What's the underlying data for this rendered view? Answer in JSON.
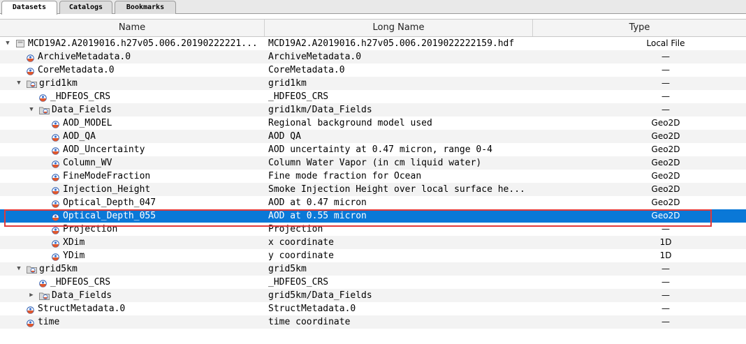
{
  "tabs": [
    "Datasets",
    "Catalogs",
    "Bookmarks"
  ],
  "columns": {
    "name": "Name",
    "long_name": "Long Name",
    "type": "Type"
  },
  "rows": [
    {
      "name": "MCD19A2.A2019016.h27v05.006.20190222221...",
      "long": "MCD19A2.A2019016.h27v05.006.2019022222159.hdf",
      "type": "Local File",
      "kind": "file",
      "level": 0,
      "arrow": "down"
    },
    {
      "name": "ArchiveMetadata.0",
      "long": "ArchiveMetadata.0",
      "type": "—",
      "kind": "ds",
      "level": 1
    },
    {
      "name": "CoreMetadata.0",
      "long": "CoreMetadata.0",
      "type": "—",
      "kind": "ds",
      "level": 1
    },
    {
      "name": "grid1km",
      "long": "grid1km",
      "type": "—",
      "kind": "folder",
      "level": 1,
      "arrow": "down"
    },
    {
      "name": "_HDFEOS_CRS",
      "long": "_HDFEOS_CRS",
      "type": "—",
      "kind": "ds",
      "level": 2
    },
    {
      "name": "Data_Fields",
      "long": "grid1km/Data_Fields",
      "type": "—",
      "kind": "folder",
      "level": 2,
      "arrow": "down"
    },
    {
      "name": "AOD_MODEL",
      "long": "Regional background model used",
      "type": "Geo2D",
      "kind": "ds",
      "level": 3
    },
    {
      "name": "AOD_QA",
      "long": "AOD QA",
      "type": "Geo2D",
      "kind": "ds",
      "level": 3
    },
    {
      "name": "AOD_Uncertainty",
      "long": "AOD uncertainty at 0.47 micron, range 0-4",
      "type": "Geo2D",
      "kind": "ds",
      "level": 3
    },
    {
      "name": "Column_WV",
      "long": "Column Water Vapor (in cm liquid water)",
      "type": "Geo2D",
      "kind": "ds",
      "level": 3
    },
    {
      "name": "FineModeFraction",
      "long": "Fine mode fraction for Ocean",
      "type": "Geo2D",
      "kind": "ds",
      "level": 3
    },
    {
      "name": "Injection_Height",
      "long": "Smoke Injection Height over local surface he...",
      "type": "Geo2D",
      "kind": "ds",
      "level": 3
    },
    {
      "name": "Optical_Depth_047",
      "long": "AOD at 0.47 micron",
      "type": "Geo2D",
      "kind": "ds",
      "level": 3
    },
    {
      "name": "Optical_Depth_055",
      "long": "AOD at 0.55 micron",
      "type": "Geo2D",
      "kind": "ds",
      "level": 3,
      "selected": true
    },
    {
      "name": "Projection",
      "long": "Projection",
      "type": "—",
      "kind": "ds",
      "level": 3
    },
    {
      "name": "XDim",
      "long": "x coordinate",
      "type": "1D",
      "kind": "ds",
      "level": 3
    },
    {
      "name": "YDim",
      "long": "y coordinate",
      "type": "1D",
      "kind": "ds",
      "level": 3
    },
    {
      "name": "grid5km",
      "long": "grid5km",
      "type": "—",
      "kind": "folder",
      "level": 1,
      "arrow": "down"
    },
    {
      "name": "_HDFEOS_CRS",
      "long": "_HDFEOS_CRS",
      "type": "—",
      "kind": "ds",
      "level": 2
    },
    {
      "name": "Data_Fields",
      "long": "grid5km/Data_Fields",
      "type": "—",
      "kind": "folder",
      "level": 2,
      "arrow": "right"
    },
    {
      "name": "StructMetadata.0",
      "long": "StructMetadata.0",
      "type": "—",
      "kind": "ds",
      "level": 1
    },
    {
      "name": "time",
      "long": "time coordinate",
      "type": "—",
      "kind": "ds",
      "level": 1
    }
  ],
  "colors": {
    "selection": "#0a78d7",
    "highlight_box": "#e23a3a"
  }
}
